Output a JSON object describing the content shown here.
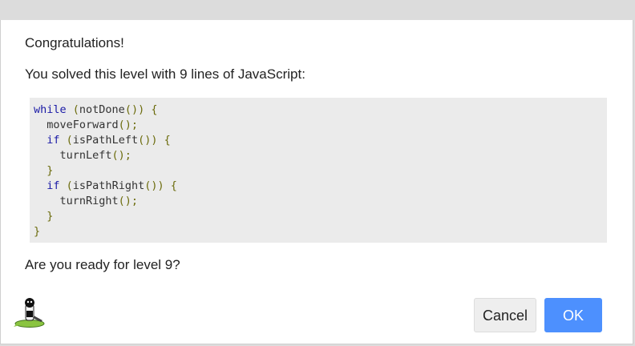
{
  "dialog": {
    "heading": "Congratulations!",
    "solved_message": "You solved this level with 9 lines of JavaScript:",
    "ready_prompt": "Are you ready for level 9?",
    "code_lines": [
      {
        "indent": "",
        "parts": [
          [
            "kw",
            "while"
          ],
          [
            "pn",
            " ("
          ],
          [
            "fn",
            "notDone"
          ],
          [
            "pn",
            "()) {"
          ]
        ]
      },
      {
        "indent": "  ",
        "parts": [
          [
            "fn",
            "moveForward"
          ],
          [
            "pn",
            "();"
          ]
        ]
      },
      {
        "indent": "  ",
        "parts": [
          [
            "kw",
            "if"
          ],
          [
            "pn",
            " ("
          ],
          [
            "fn",
            "isPathLeft"
          ],
          [
            "pn",
            "()) {"
          ]
        ]
      },
      {
        "indent": "    ",
        "parts": [
          [
            "fn",
            "turnLeft"
          ],
          [
            "pn",
            "();"
          ]
        ]
      },
      {
        "indent": "  ",
        "parts": [
          [
            "pn",
            "}"
          ]
        ]
      },
      {
        "indent": "  ",
        "parts": [
          [
            "kw",
            "if"
          ],
          [
            "pn",
            " ("
          ],
          [
            "fn",
            "isPathRight"
          ],
          [
            "pn",
            "()) {"
          ]
        ]
      },
      {
        "indent": "    ",
        "parts": [
          [
            "fn",
            "turnRight"
          ],
          [
            "pn",
            "();"
          ]
        ]
      },
      {
        "indent": "  ",
        "parts": [
          [
            "pn",
            "}"
          ]
        ]
      },
      {
        "indent": "",
        "parts": [
          [
            "pn",
            "}"
          ]
        ]
      }
    ]
  },
  "buttons": {
    "cancel_label": "Cancel",
    "ok_label": "OK"
  },
  "icons": {
    "footer_icon": "pegman-on-lilypad-icon"
  },
  "colors": {
    "ok_button": "#4d90fe",
    "code_background": "#ebebeb",
    "keyword": "#1a1aa6",
    "punctuation": "#6b6b0b"
  }
}
